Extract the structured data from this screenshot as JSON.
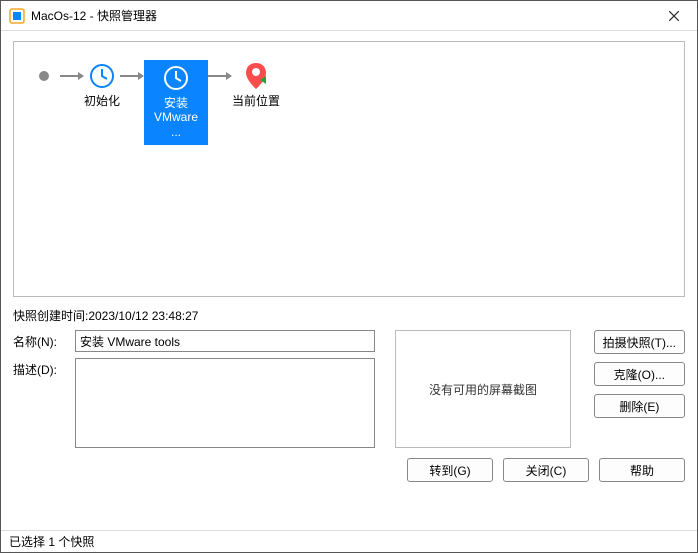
{
  "window": {
    "title": "MacOs-12 - 快照管理器",
    "close_tooltip": "Close"
  },
  "timeline": {
    "start_label": "",
    "nodes": [
      {
        "label": "初始化"
      },
      {
        "label": "安装 VMware ...",
        "selected": true
      },
      {
        "label": "当前位置",
        "is_current": true
      }
    ]
  },
  "details": {
    "created_label": "快照创建时间:2023/10/12 23:48:27",
    "name_label": "名称(N):",
    "name_value": "安装 VMware tools",
    "desc_label": "描述(D):",
    "desc_value": "",
    "preview_text": "没有可用的屏幕截图"
  },
  "side_buttons": {
    "take": "拍摄快照(T)...",
    "clone": "克隆(O)...",
    "delete": "删除(E)"
  },
  "bottom_buttons": {
    "goto": "转到(G)",
    "close": "关闭(C)",
    "help": "帮助"
  },
  "status": {
    "text": "已选择 1 个快照"
  }
}
